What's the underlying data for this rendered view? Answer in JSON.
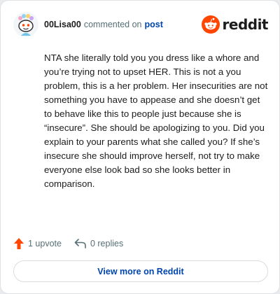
{
  "header": {
    "username": "00Lisa00",
    "commented_text": "commented on",
    "post_link": "post",
    "brand_word": "reddit"
  },
  "comment": {
    "body": "NTA she literally told you you dress like a whore and you’re trying not to upset HER. This is not a you problem, this is a her problem. Her insecurities are not something you have to appease and she doesn’t get to behave like this to people just because she is “insecure”. She should be apologizing to you. Did you explain to your parents what she called you? If she’s insecure she should improve herself, not try to make everyone else look bad so she looks better in comparison."
  },
  "actions": {
    "upvotes": "1 upvote",
    "replies": "0 replies"
  },
  "footer": {
    "view_more": "View more on Reddit"
  },
  "icons": {
    "avatar": "snoo-avatar-icon",
    "brand": "reddit-logo-icon",
    "upvote": "upvote-arrow-icon",
    "reply": "reply-arrow-icon"
  },
  "colors": {
    "reddit_orange": "#ff4500",
    "link_blue": "#0045ac",
    "muted_text": "#576f76"
  }
}
